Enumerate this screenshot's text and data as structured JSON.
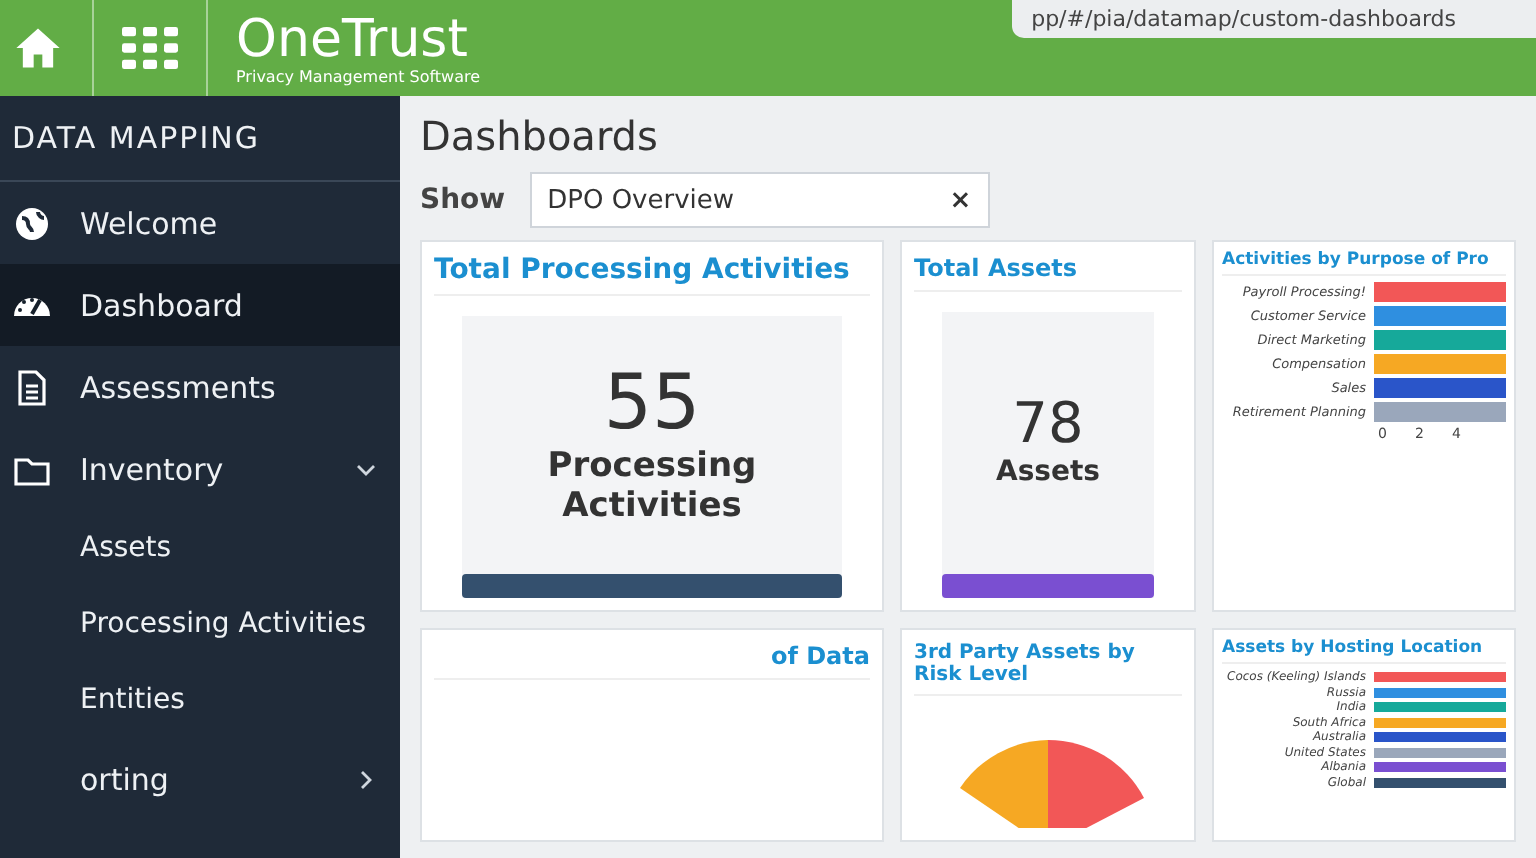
{
  "header": {
    "logo": "OneTrust",
    "tagline": "Privacy Management Software",
    "url": "pp/#/pia/datamap/custom-dashboards"
  },
  "sidebar": {
    "title": "DATA MAPPING",
    "items": [
      {
        "label": "Welcome",
        "selected": false
      },
      {
        "label": "Dashboard",
        "selected": true
      },
      {
        "label": "Assessments",
        "selected": false
      },
      {
        "label": "Inventory",
        "selected": false,
        "expanded": true,
        "children": [
          {
            "label": "Assets",
            "selected": false
          },
          {
            "label": "Processing Activities",
            "selected": false
          },
          {
            "label": "Entities",
            "selected": false
          }
        ]
      },
      {
        "label": "orting",
        "selected": false,
        "expanded": false
      }
    ]
  },
  "page": {
    "title": "Dashboards",
    "show_label": "Show",
    "show_value": "DPO Overview",
    "clear": "×"
  },
  "cards": [
    {
      "kind": "stat",
      "title": "Total Processing Activities",
      "value": "55",
      "label": "Processing Activities",
      "color": "#34506e"
    },
    {
      "kind": "stat",
      "title": "Total Assets",
      "value": "78",
      "label": "Assets",
      "color": "#7a4fd1"
    },
    {
      "kind": "bars",
      "title": "Activities by Purpose of Pro",
      "bars": [
        {
          "label": "Payroll Processing!",
          "color": "#f25757"
        },
        {
          "label": "Customer Service",
          "color": "#2f8fe0"
        },
        {
          "label": "Direct Marketing",
          "color": "#16a99a"
        },
        {
          "label": "Compensation",
          "color": "#f6a823"
        },
        {
          "label": "Sales",
          "color": "#2a55c9"
        },
        {
          "label": "Retirement Planning",
          "color": "#9aa7bb"
        }
      ],
      "ticks": [
        "0",
        "2",
        "4"
      ]
    },
    {
      "kind": "partial",
      "title": "of Data"
    },
    {
      "kind": "pie",
      "title": "3rd Party Assets by Risk Level"
    },
    {
      "kind": "bars",
      "title": "Assets by Hosting Location",
      "bars": [
        {
          "label": "Cocos (Keeling) Islands",
          "color": "#f25757"
        },
        {
          "label": "Russia",
          "color": "#2f8fe0"
        },
        {
          "label": "India",
          "color": "#16a99a"
        },
        {
          "label": "South Africa",
          "color": "#f6a823"
        },
        {
          "label": "Australia",
          "color": "#2a55c9"
        },
        {
          "label": "United States",
          "color": "#9aa7bb"
        },
        {
          "label": "Albania",
          "color": "#7a4fd1"
        },
        {
          "label": "Global",
          "color": "#34506e"
        }
      ]
    }
  ]
}
